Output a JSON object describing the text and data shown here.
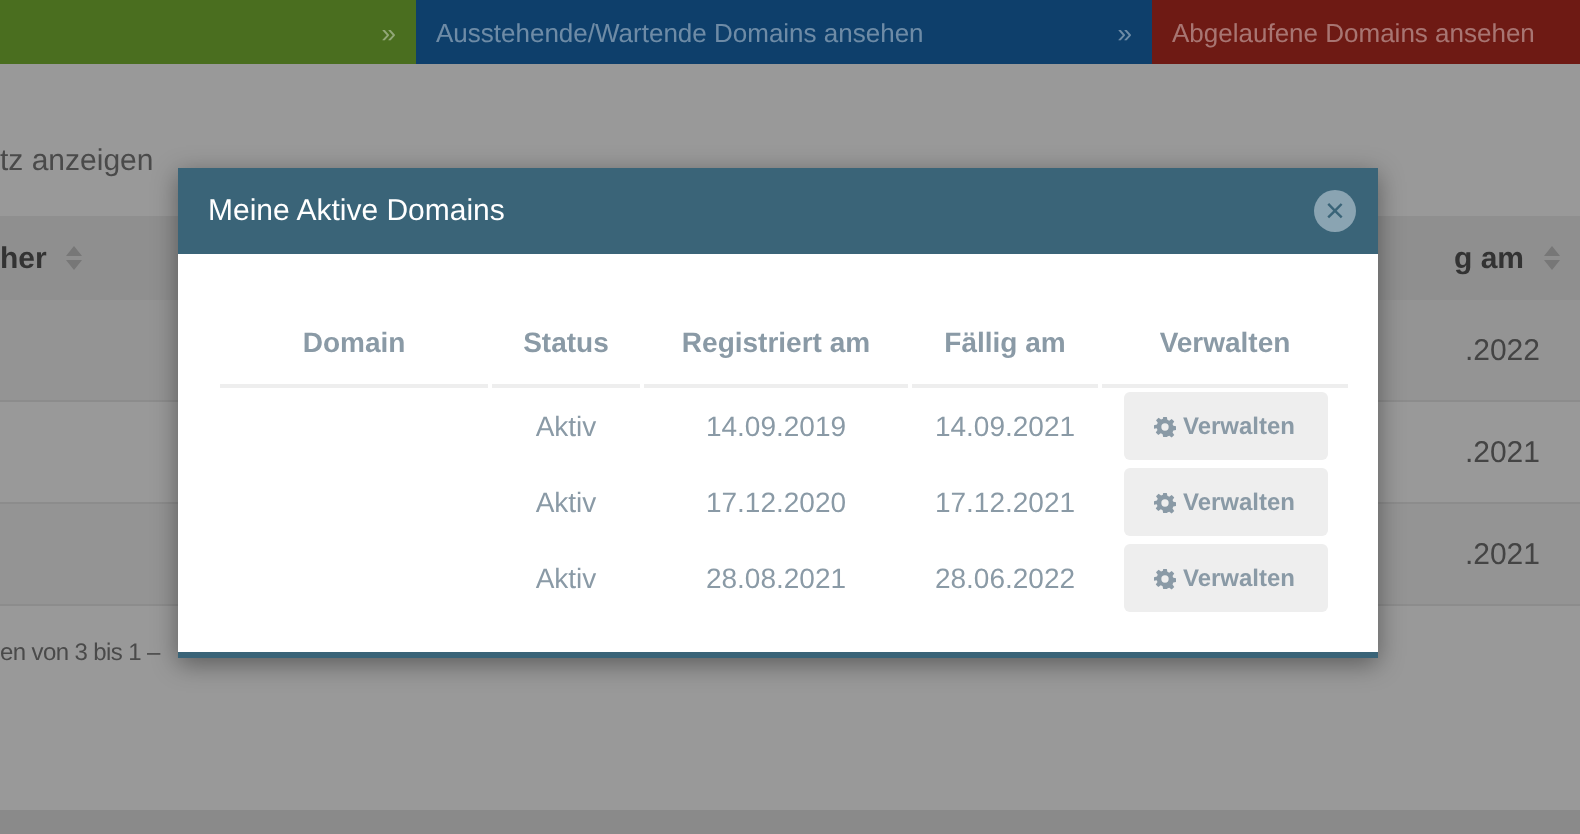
{
  "tiles": [
    {
      "arrow": "»",
      "color": "#4a6e1f"
    },
    {
      "label": "Ausstehende/Wartende Domains ansehen",
      "arrow": "»",
      "color": "#0e3f6b"
    },
    {
      "label": "Abgelaufene Domains ansehen",
      "color": "#6e1a14"
    }
  ],
  "page": {
    "entries_label": "tz anzeigen",
    "table": {
      "columns": [
        "her",
        "g am"
      ],
      "rows": [
        {
          "column_2": ".2022"
        },
        {
          "column_2": ".2021"
        },
        {
          "column_2": ".2021"
        }
      ]
    },
    "footer": "en von 3 bis 1 –"
  },
  "modal": {
    "title": "Meine Aktive Domains",
    "close": "×",
    "columns": [
      "Domain",
      "Status",
      "Registriert am",
      "Fällig am",
      "Verwalten"
    ],
    "rows": [
      {
        "status": "Aktiv",
        "registered": "14.09.2019",
        "due": "14.09.2021",
        "action": "Verwalten"
      },
      {
        "status": "Aktiv",
        "registered": "17.12.2020",
        "due": "17.12.2021",
        "action": "Verwalten"
      },
      {
        "status": "Aktiv",
        "registered": "28.08.2021",
        "due": "28.06.2022",
        "action": "Verwalten"
      }
    ]
  }
}
